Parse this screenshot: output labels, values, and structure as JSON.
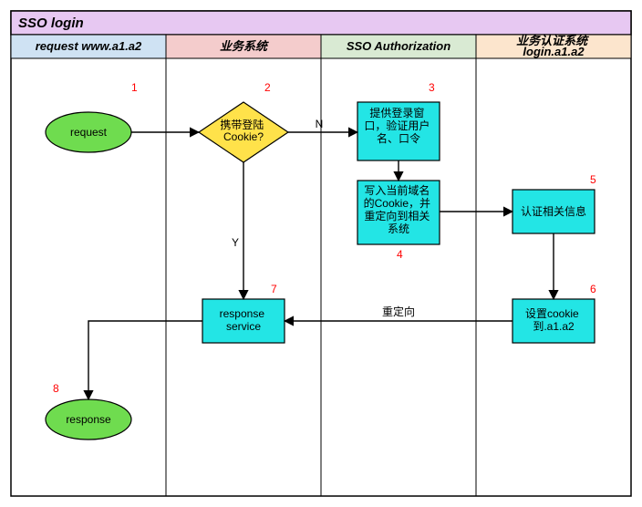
{
  "title": "SSO login",
  "lanes": {
    "l1": "request www.a1.a2",
    "l2": "业务系统",
    "l3": "SSO Authorization",
    "l4": "业务认证系统 login.a1.a2"
  },
  "nodes": {
    "request": "request",
    "cookie_check": "携带登陆Cookie?",
    "login_window": "提供登录窗口，验证用户名、口令",
    "write_cookie": "写入当前域名的Cookie，并重定向到相关系统",
    "auth_info": "认证相关信息",
    "set_cookie": "设置cookie到.a1.a2",
    "response_service": "response service",
    "response": "response"
  },
  "edges": {
    "no": "N",
    "yes": "Y",
    "redirect": "重定向"
  },
  "nums": {
    "n1": "1",
    "n2": "2",
    "n3": "3",
    "n4": "4",
    "n5": "5",
    "n6": "6",
    "n7": "7",
    "n8": "8"
  },
  "colors": {
    "title_bg": "#e7c8f2",
    "lane1_bg": "#cfe2f3",
    "lane2_bg": "#f4cccc",
    "lane3_bg": "#d9ead3",
    "lane4_bg": "#fce5cd",
    "oval_fill": "#6fdc4f",
    "diamond_fill": "#ffe24a",
    "box_fill": "#23e5e5",
    "stroke": "#000000"
  }
}
